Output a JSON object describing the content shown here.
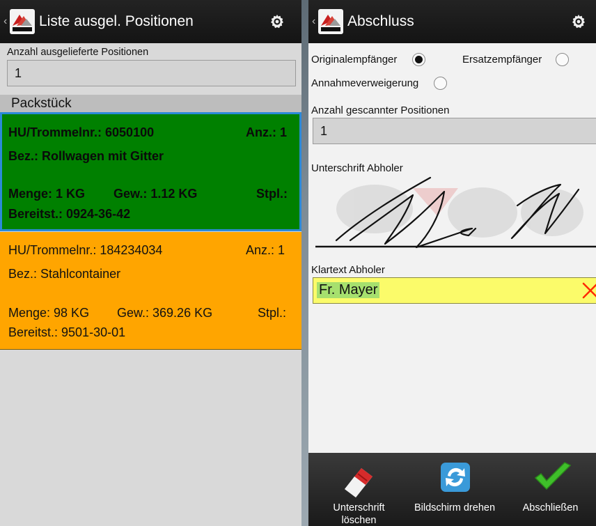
{
  "left_screen": {
    "title": "Liste ausgel. Positionen",
    "count_label": "Anzahl ausgelieferte Positionen",
    "count_value": "1",
    "section_header": "Packstück",
    "items": [
      {
        "hu": "HU/Trommelnr.: 6050100",
        "anz": "Anz.: 1",
        "bez": "Bez.: Rollwagen mit Gitter",
        "menge": "Menge: 1 KG",
        "gew": "Gew.: 1.12 KG",
        "stpl": "Stpl.:",
        "bereitst": "Bereitst.: 0924-36-42",
        "color": "#008000",
        "selected": true
      },
      {
        "hu": "HU/Trommelnr.: 184234034",
        "anz": "Anz.: 1",
        "bez": "Bez.: Stahlcontainer",
        "menge": "Menge: 98 KG",
        "gew": "Gew.: 369.26 KG",
        "stpl": "Stpl.:",
        "bereitst": "Bereitst.: 9501-30-01",
        "color": "#ffa500",
        "selected": false
      }
    ]
  },
  "right_screen": {
    "title": "Abschluss",
    "recipient_options": [
      {
        "label": "Originalempfänger",
        "selected": true
      },
      {
        "label": "Ersatzempfänger",
        "selected": false
      },
      {
        "label": "Annahmeverweigerung",
        "selected": false
      }
    ],
    "scanned_label": "Anzahl gescannter Positionen",
    "scanned_value": "1",
    "signature_label": "Unterschrift Abholer",
    "klartext_label": "Klartext Abholer",
    "klartext_value": "Fr. Mayer",
    "actions": [
      {
        "label": "Unterschrift löschen",
        "icon": "eraser-icon"
      },
      {
        "label": "Bildschirm drehen",
        "icon": "rotate-screen-icon"
      },
      {
        "label": "Abschließen",
        "icon": "checkmark-icon"
      }
    ]
  },
  "colors": {
    "appbar": "#1b1b1b",
    "item_selected_border": "#2b8ad8",
    "klartext_bg": "#fbfb6a",
    "clear_x": "#ff2a00",
    "check_green": "#3fbf2a"
  }
}
